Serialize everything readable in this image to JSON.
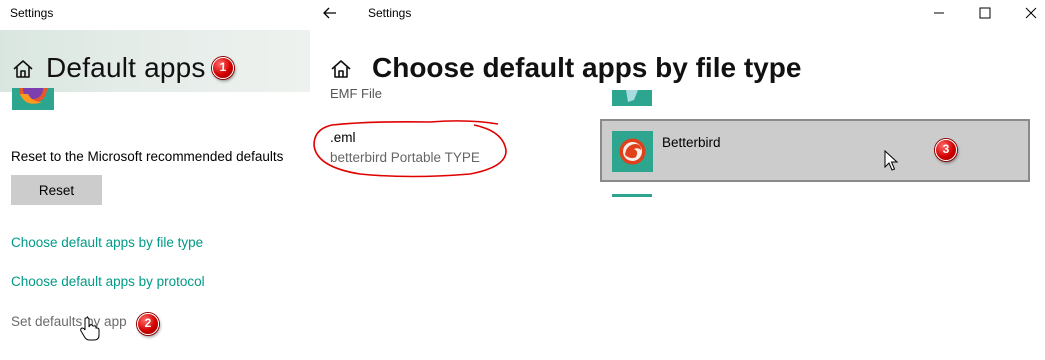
{
  "left_window": {
    "title": "Settings",
    "heading": "Default apps",
    "reset_label": "Reset to the Microsoft recommended defaults",
    "reset_button": "Reset",
    "links": [
      "Choose default apps by file type",
      "Choose default apps by protocol",
      "Set defaults by app"
    ],
    "badges": [
      "1",
      "2"
    ]
  },
  "right_window": {
    "title": "Settings",
    "heading": "Choose default apps by file type",
    "partial_item": "EMF File",
    "file_type": {
      "extension": ".eml",
      "description": "betterbird Portable TYPE"
    },
    "selected_app": "Betterbird",
    "badge": "3"
  },
  "colors": {
    "accent": "#009a86",
    "tile": "#2ea58f",
    "selected_bg": "#cccccc",
    "annotation_red": "#d40000"
  },
  "icons": [
    "home-icon",
    "back-arrow-icon",
    "minimize-icon",
    "maximize-icon",
    "close-icon",
    "firefox-icon",
    "betterbird-icon",
    "mouse-pointer-icon",
    "hand-pointer-icon"
  ]
}
